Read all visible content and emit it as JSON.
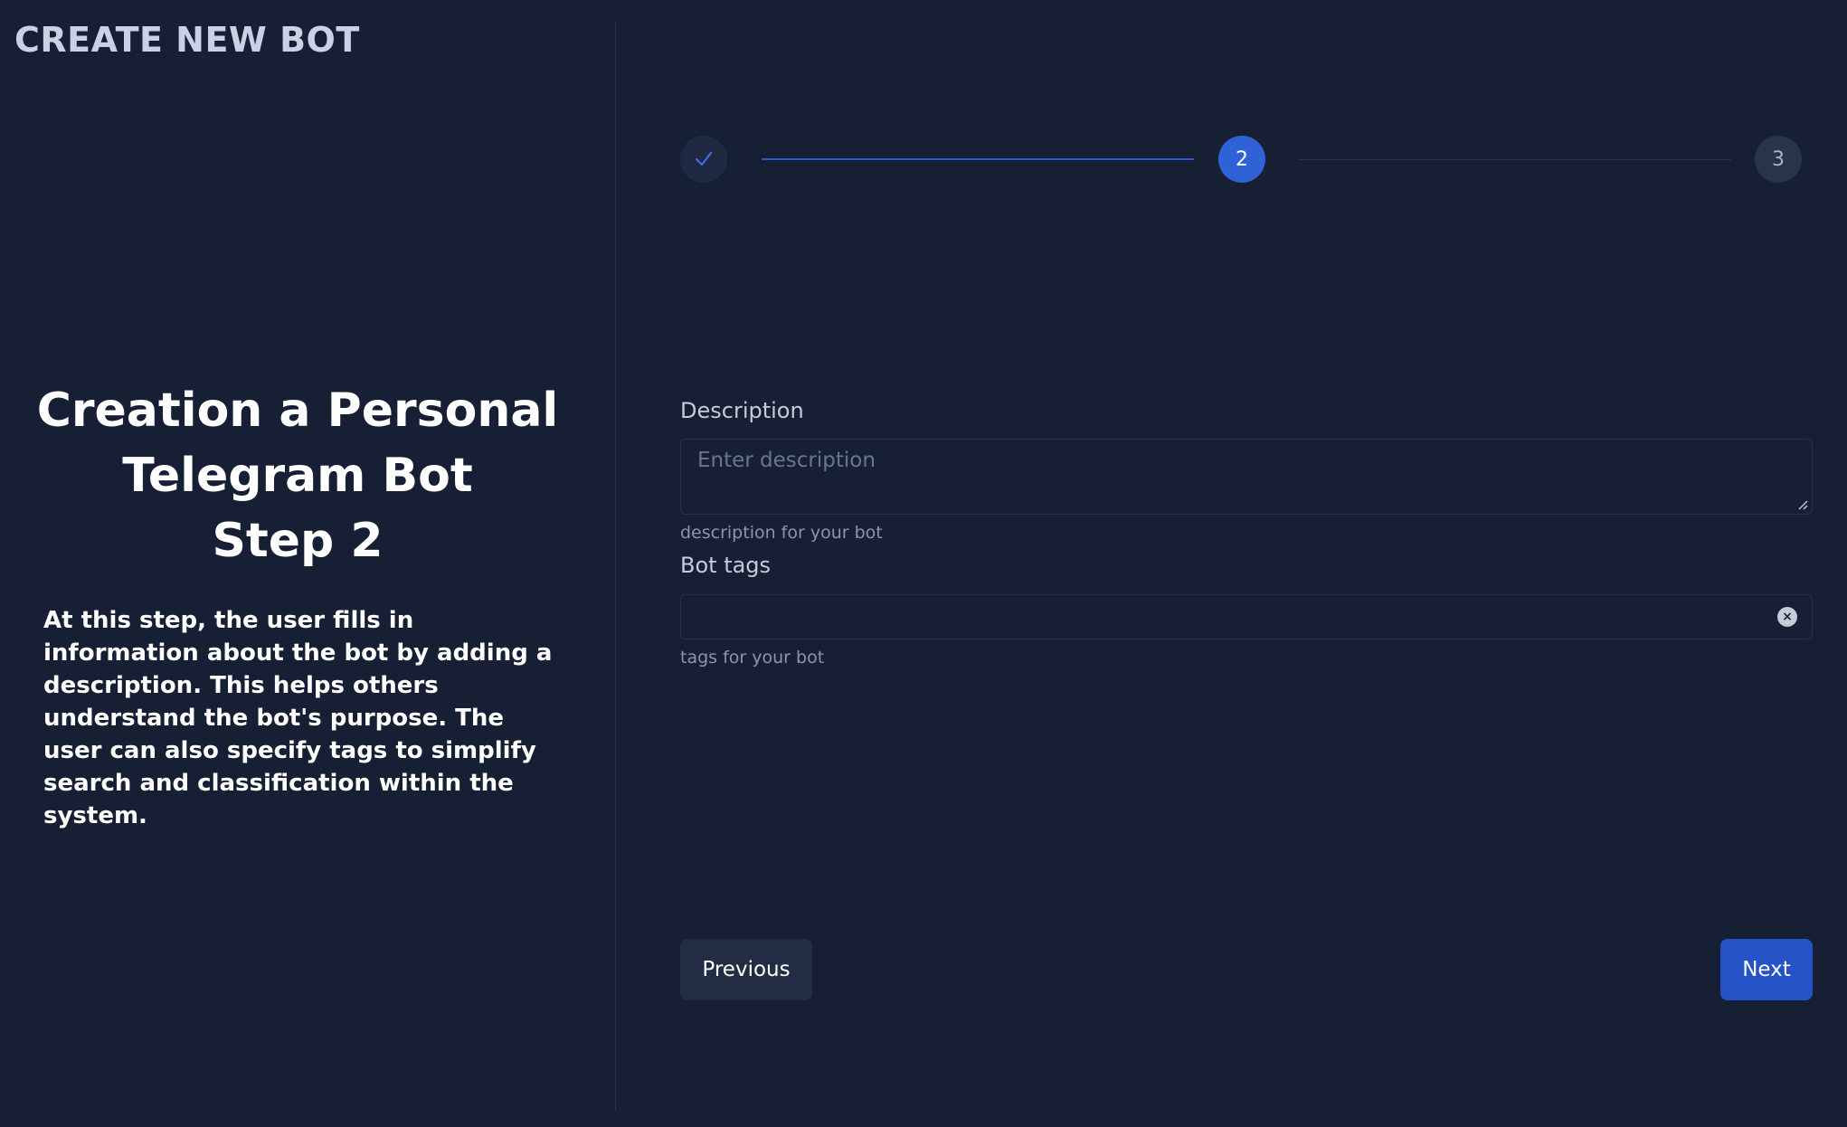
{
  "app": {
    "title": "CREATE NEW BOT"
  },
  "info_panel": {
    "heading_lines": [
      "Creation a Personal",
      "Telegram Bot",
      "Step 2"
    ],
    "description": "At this step, the user fills in information about the bot by adding a description. This helps others understand the bot's purpose. The user can also specify tags to simplify search and classification within the system."
  },
  "stepper": {
    "steps": [
      {
        "label": "",
        "status": "completed",
        "icon": "check-icon"
      },
      {
        "label": "2",
        "status": "active"
      },
      {
        "label": "3",
        "status": "upcoming"
      }
    ],
    "accent_color": "#2f62d6"
  },
  "form": {
    "description": {
      "label": "Description",
      "placeholder": "Enter description",
      "value": "",
      "helper": "description for your bot"
    },
    "tags": {
      "label": "Bot tags",
      "value": "",
      "helper": "tags for your bot",
      "clear_icon": "clear-icon"
    }
  },
  "actions": {
    "previous_label": "Previous",
    "next_label": "Next"
  },
  "colors": {
    "background": "#161f33",
    "primary_button": "#2553c7",
    "secondary_button": "#222c42"
  }
}
